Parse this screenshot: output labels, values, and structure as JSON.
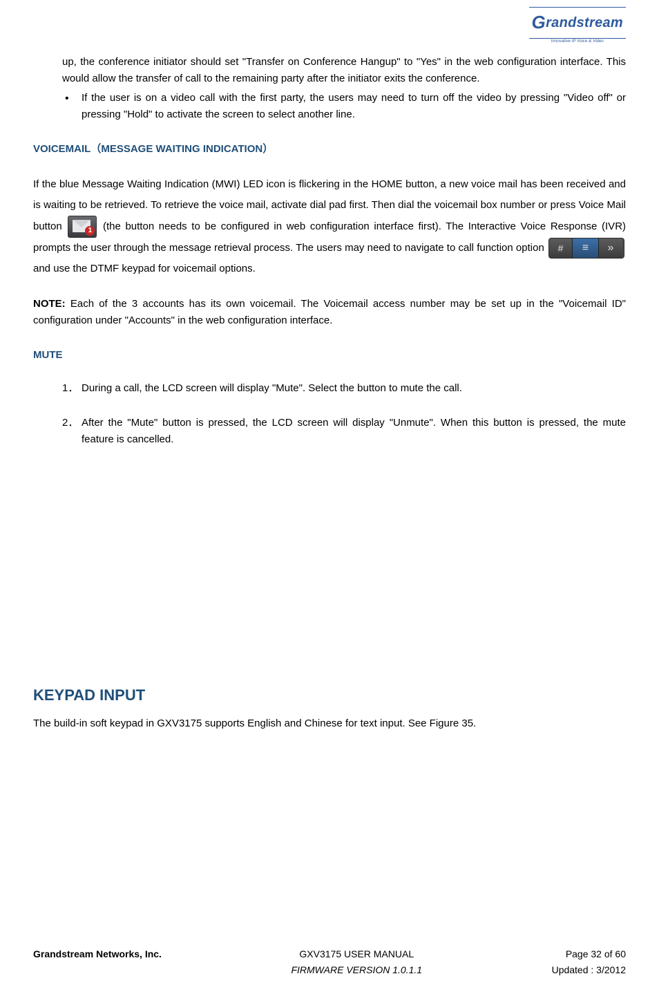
{
  "logo": {
    "brand_g": "G",
    "brand_rest": "randstream",
    "tagline": "Innovative IP Voice & Video"
  },
  "content": {
    "cont_para": "up, the conference initiator should set \"Transfer on Conference Hangup\" to \"Yes\" in the web configuration interface. This would allow the transfer of call to the remaining party after the initiator exits the conference.",
    "bullet1": "If the user is on a video call with the first party, the users may need to turn off the video by pressing \"Video off\" or pressing \"Hold\" to activate the screen to select another line.",
    "voicemail_heading": "VOICEMAIL（MESSAGE WAITING INDICATION）",
    "voicemail_para_a": "If the blue Message Waiting Indication (MWI) LED icon is flickering in the HOME button, a new voice mail has been received and is waiting to be retrieved. To retrieve the voice mail, activate dial pad first. Then dial the voicemail box number or press Voice Mail button ",
    "voicemail_para_b": " (the button needs to be configured in web configuration interface first). The Interactive Voice Response (IVR) prompts the user through the message retrieval process. The users may need to navigate to call function option ",
    "voicemail_para_c": " and use the DTMF keypad for voicemail options.",
    "mail_badge": "1",
    "callfn_hash": "#",
    "callfn_menu": "≡",
    "callfn_arrow": "»",
    "note_label": "NOTE:",
    "note_text": " Each of the 3 accounts has its own voicemail. The Voicemail access number may be set up in the \"Voicemail ID\" configuration under \"Accounts\" in the web configuration interface.",
    "mute_heading": "MUTE",
    "mute_item1_num": "1．",
    "mute_item1": "During a call, the LCD screen will display \"Mute\". Select the button to mute the call.",
    "mute_item2_num": "2．",
    "mute_item2": "After the \"Mute\" button is pressed, the LCD screen will display \"Unmute\". When this button is pressed, the mute feature is cancelled.",
    "keypad_heading": "KEYPAD INPUT",
    "keypad_para": "The build-in soft keypad in GXV3175 supports English and Chinese for text input. See Figure 35."
  },
  "footer": {
    "company": "Grandstream Networks, Inc.",
    "manual": "GXV3175 USER MANUAL",
    "firmware": "FIRMWARE VERSION 1.0.1.1",
    "page": "Page 32 of 60",
    "updated": "Updated : 3/2012"
  }
}
